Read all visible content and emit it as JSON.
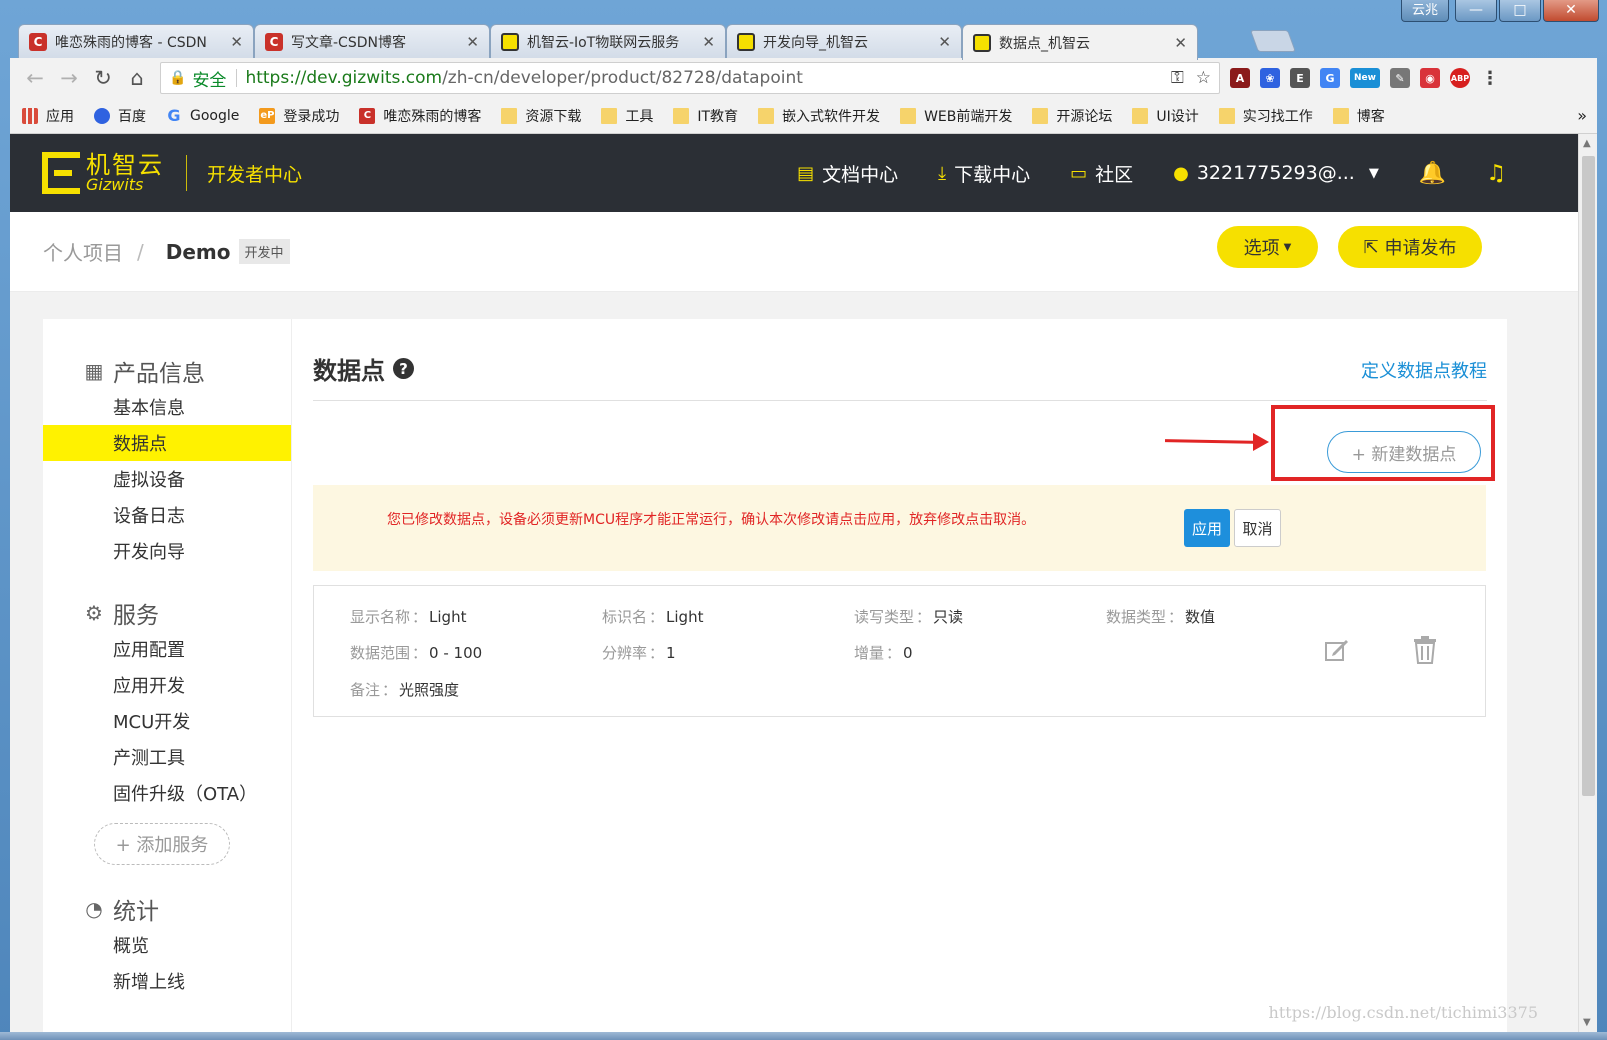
{
  "window": {
    "label": "云兆",
    "minimize": "—",
    "maximize": "□",
    "close": "✕"
  },
  "tabs": [
    {
      "title": "唯恋殊雨的博客 - CSDN",
      "icon": "csdn-icon"
    },
    {
      "title": "写文章-CSDN博客",
      "icon": "csdn-icon"
    },
    {
      "title": "机智云-IoT物联网云服务",
      "icon": "gizwits-icon"
    },
    {
      "title": "开发向导_机智云",
      "icon": "gizwits-icon"
    },
    {
      "title": "数据点_机智云",
      "icon": "gizwits-icon",
      "active": true
    }
  ],
  "toolbar": {
    "secure": "安全",
    "url_host": "https://dev.gizwits.com",
    "url_path": "/zh-cn/developer/product/82728/datapoint",
    "ext_new": "New",
    "ext_abp": "ABP"
  },
  "bookmarks": [
    {
      "label": "应用",
      "icon": "apps-icon"
    },
    {
      "label": "百度",
      "icon": "baidu-icon"
    },
    {
      "label": "Google",
      "icon": "google-icon"
    },
    {
      "label": "登录成功",
      "icon": "ep-icon"
    },
    {
      "label": "唯恋殊雨的博客",
      "icon": "csdn-icon"
    },
    {
      "label": "资源下载",
      "icon": "folder-icon"
    },
    {
      "label": "工具",
      "icon": "folder-icon"
    },
    {
      "label": "IT教育",
      "icon": "folder-icon"
    },
    {
      "label": "嵌入式软件开发",
      "icon": "folder-icon"
    },
    {
      "label": "WEB前端开发",
      "icon": "folder-icon"
    },
    {
      "label": "开源论坛",
      "icon": "folder-icon"
    },
    {
      "label": "UI设计",
      "icon": "folder-icon"
    },
    {
      "label": "实习找工作",
      "icon": "folder-icon"
    },
    {
      "label": "博客",
      "icon": "folder-icon"
    }
  ],
  "header": {
    "logo_cn": "机智云",
    "logo_en": "Gizwits",
    "center": "开发者中心",
    "nav": {
      "docs": "文档中心",
      "download": "下载中心",
      "community": "社区",
      "user": "3221775293@..."
    }
  },
  "breadcrumb": {
    "parent": "个人项目",
    "separator": "/",
    "current": "Demo",
    "badge": "开发中"
  },
  "actions": {
    "options": "选项",
    "publish": "申请发布"
  },
  "sidebar": {
    "sections": [
      {
        "title": "产品信息",
        "icon": "grid-icon",
        "items": [
          "基本信息",
          "数据点",
          "虚拟设备",
          "设备日志",
          "开发向导"
        ],
        "active": 1
      },
      {
        "title": "服务",
        "icon": "service-icon",
        "items": [
          "应用配置",
          "应用开发",
          "MCU开发",
          "产测工具",
          "固件升级（OTA）"
        ],
        "active": -1
      },
      {
        "title": "统计",
        "icon": "pie-chart-icon",
        "items": [
          "概览",
          "新增上线"
        ],
        "active": -1
      }
    ],
    "add_service": "+ 添加服务"
  },
  "content": {
    "title": "数据点",
    "tutorial_link": "定义数据点教程",
    "new_datapoint": "+ 新建数据点",
    "warning": "您已修改数据点，设备必须更新MCU程序才能正常运行，确认本次修改请点击应用，放弃修改点击取消。",
    "apply": "应用",
    "cancel": "取消"
  },
  "datapoint": {
    "display_name_label": "显示名称",
    "display_name": "Light",
    "identifier_label": "标识名",
    "identifier": "Light",
    "rw_label": "读写类型",
    "rw": "只读",
    "type_label": "数据类型",
    "type": "数值",
    "range_label": "数据范围",
    "range": "0 - 100",
    "resolution_label": "分辨率",
    "resolution": "1",
    "increment_label": "增量",
    "increment": "0",
    "remark_label": "备注",
    "remark": "光照强度"
  },
  "watermark": "https://blog.csdn.net/tichimi3375",
  "colors": {
    "brand_yellow": "#f6e000",
    "header_dark": "#2b2f35",
    "link_blue": "#1a8fd6",
    "warn_red": "#e12525",
    "apply_blue": "#1e8fdc"
  }
}
